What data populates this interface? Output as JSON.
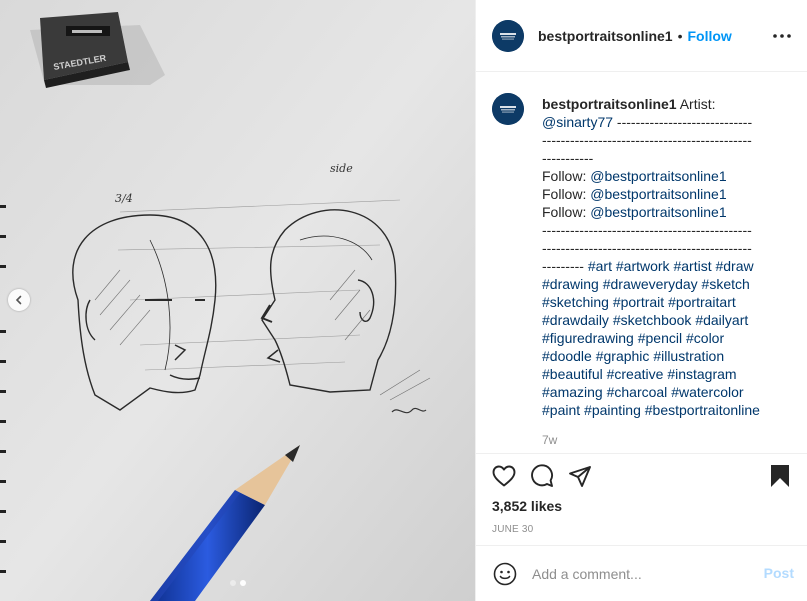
{
  "header": {
    "username": "bestportraitsonline1",
    "separator": "•",
    "follow_label": "Follow",
    "more_label": "More options"
  },
  "image": {
    "sharpener_brand": "STAEDTLER",
    "sketch_label_left": "3/4",
    "sketch_label_right": "side",
    "carousel_total": 2,
    "carousel_active": 2
  },
  "caption": {
    "username": "bestportraitsonline1",
    "intro": "Artist:",
    "mention": "@sinarty77",
    "dash_1_tail": "-----------------------------",
    "dash_2": "---------------------------------------------",
    "dash_3": "-----------",
    "follow_lines": [
      {
        "prefix": "Follow: ",
        "mention": "@bestportraitsonline1"
      },
      {
        "prefix": "Follow: ",
        "mention": "@bestportraitsonline1"
      },
      {
        "prefix": "Follow: ",
        "mention": "@bestportraitsonline1"
      }
    ],
    "dash_4": "---------------------------------------------",
    "dash_5": "---------------------------------------------",
    "dash_6": "---------",
    "hashtag_lines": [
      [
        "#art",
        "#artwork",
        "#artist",
        "#draw"
      ],
      [
        "#drawing",
        "#draweveryday",
        "#sketch"
      ],
      [
        "#sketching",
        "#portrait",
        "#portraitart"
      ],
      [
        "#drawdaily",
        "#sketchbook",
        "#dailyart"
      ],
      [
        "#figuredrawing",
        "#pencil",
        "#color"
      ],
      [
        "#doodle",
        "#graphic",
        "#illustration"
      ],
      [
        "#beautiful",
        "#creative",
        "#instagram"
      ],
      [
        "#amazing",
        "#charcoal",
        "#watercolor"
      ],
      [
        "#paint",
        "#painting",
        "#bestportraitonline"
      ]
    ],
    "time_ago": "7w"
  },
  "actions": {
    "likes": "3,852 likes",
    "date": "JUNE 30"
  },
  "comment": {
    "placeholder": "Add a comment...",
    "post_label": "Post"
  },
  "colors": {
    "accent": "#0095f6",
    "mention": "#00376b",
    "muted": "#8e8e8e",
    "post_disabled": "#b3dbff"
  }
}
